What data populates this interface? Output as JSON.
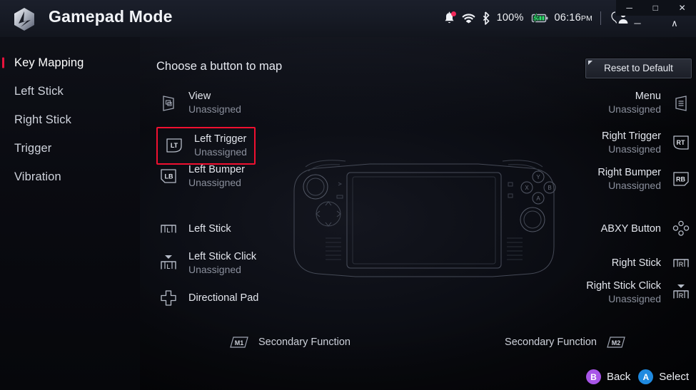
{
  "window": {
    "title": "Gamepad Mode",
    "logo_icon": "armoury-crate-logo-icon",
    "os_controls": {
      "minimize": "─",
      "maximize": "□",
      "close": "✕"
    },
    "app_controls": {
      "minimize": "─",
      "collapse": "∧"
    }
  },
  "status_bar": {
    "notification_icon": "bell-icon",
    "notification_badge": true,
    "wifi_icon": "wifi-icon",
    "bluetooth_icon": "bluetooth-icon",
    "battery_percent": "100%",
    "battery_icon": "battery-charging-icon",
    "time": "06:16",
    "time_period": "PM",
    "user_icon": "user-account-icon"
  },
  "sidebar": {
    "items": [
      {
        "label": "Key Mapping",
        "active": true
      },
      {
        "label": "Left Stick",
        "active": false
      },
      {
        "label": "Right Stick",
        "active": false
      },
      {
        "label": "Trigger",
        "active": false
      },
      {
        "label": "Vibration",
        "active": false
      }
    ]
  },
  "main": {
    "heading": "Choose a button to map",
    "reset_button": "Reset to Default",
    "device_illustration": "handheld-gamepad-device-outline"
  },
  "mappings": {
    "left": [
      {
        "id": "view",
        "icon": "view-button-icon",
        "label": "View",
        "value": "Unassigned",
        "highlighted": false
      },
      {
        "id": "left-trigger",
        "icon": "lt-trigger-icon",
        "label": "Left Trigger",
        "value": "Unassigned",
        "highlighted": true
      },
      {
        "id": "left-bumper",
        "icon": "lb-bumper-icon",
        "label": "Left Bumper",
        "value": "Unassigned",
        "highlighted": false
      },
      {
        "id": "left-stick",
        "icon": "left-stick-icon",
        "label": "Left Stick",
        "value": "",
        "highlighted": false
      },
      {
        "id": "left-stick-click",
        "icon": "left-stick-click-icon",
        "label": "Left Stick Click",
        "value": "Unassigned",
        "highlighted": false
      },
      {
        "id": "directional-pad",
        "icon": "dpad-icon",
        "label": "Directional Pad",
        "value": "",
        "highlighted": false
      }
    ],
    "right": [
      {
        "id": "menu",
        "icon": "menu-button-icon",
        "label": "Menu",
        "value": "Unassigned"
      },
      {
        "id": "right-trigger",
        "icon": "rt-trigger-icon",
        "label": "Right Trigger",
        "value": "Unassigned"
      },
      {
        "id": "right-bumper",
        "icon": "rb-bumper-icon",
        "label": "Right Bumper",
        "value": "Unassigned"
      },
      {
        "id": "abxy-button",
        "icon": "abxy-buttons-icon",
        "label": "ABXY Button",
        "value": ""
      },
      {
        "id": "right-stick",
        "icon": "right-stick-icon",
        "label": "Right Stick",
        "value": ""
      },
      {
        "id": "right-stick-click",
        "icon": "right-stick-click-icon",
        "label": "Right Stick Click",
        "value": "Unassigned"
      }
    ]
  },
  "secondary": {
    "left": {
      "icon": "m1-button-icon",
      "key": "M1",
      "label": "Secondary Function"
    },
    "right": {
      "icon": "m2-button-icon",
      "key": "M2",
      "label": "Secondary Function"
    }
  },
  "footer": {
    "back": {
      "glyph": "B",
      "label": "Back",
      "color": "#a855e8"
    },
    "select": {
      "glyph": "A",
      "label": "Select",
      "color": "#1f8ae0"
    }
  }
}
